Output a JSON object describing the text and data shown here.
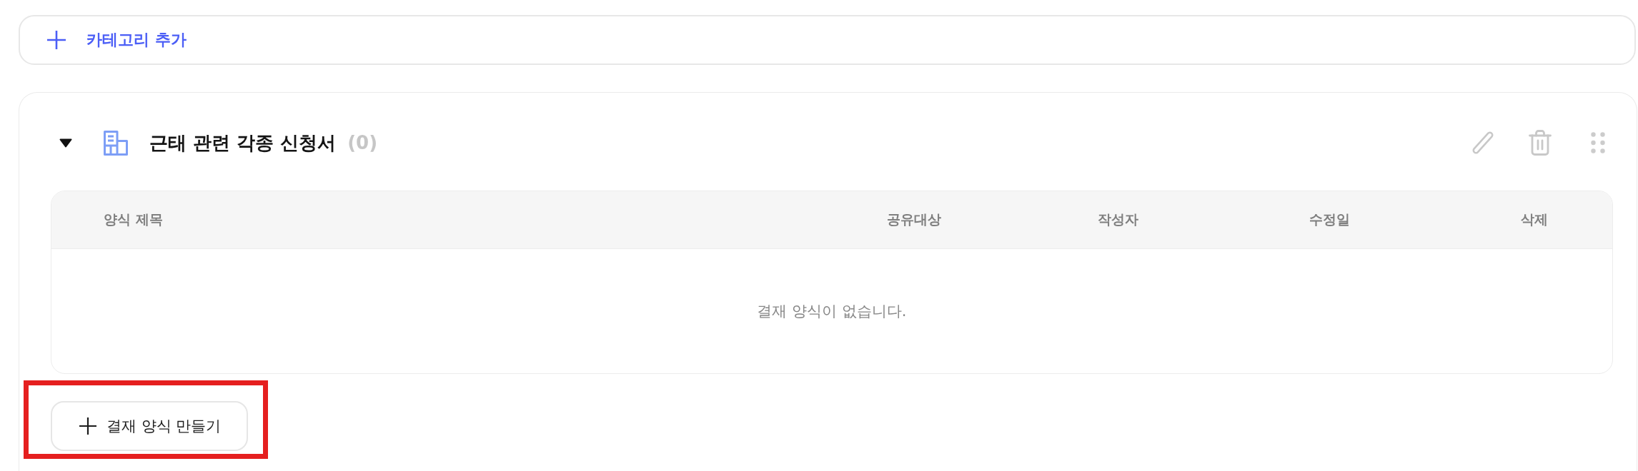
{
  "add_category": {
    "label": "카테고리 추가"
  },
  "category": {
    "title": "근태 관련 각종 신청서",
    "count": "(0)",
    "expanded": true,
    "table": {
      "columns": [
        "양식 제목",
        "공유대상",
        "작성자",
        "수정일",
        "삭제"
      ],
      "empty_message": "결재 양식이 없습니다."
    },
    "create_button": {
      "label": "결재 양식 만들기",
      "highlighted": true
    }
  }
}
